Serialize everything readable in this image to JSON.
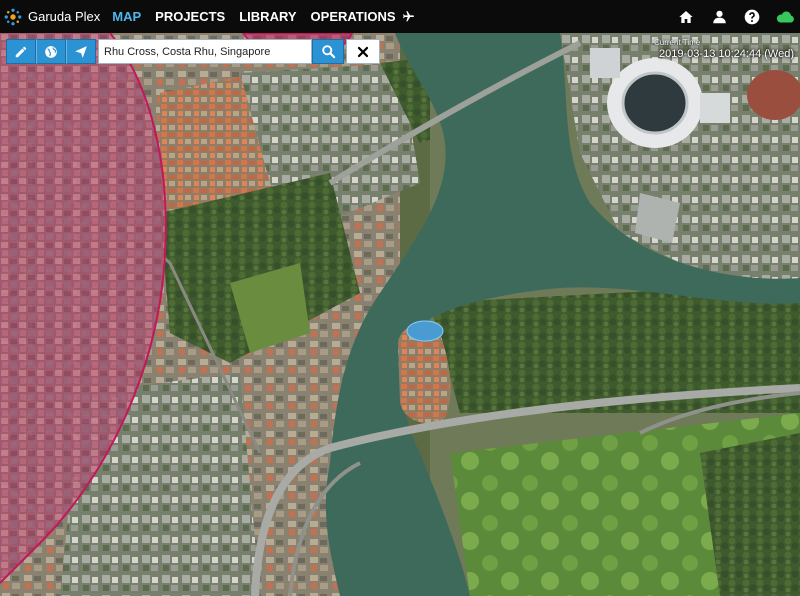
{
  "app": {
    "brand": "Garuda Plex"
  },
  "nav": {
    "items": [
      {
        "label": "MAP",
        "active": true
      },
      {
        "label": "PROJECTS",
        "active": false
      },
      {
        "label": "LIBRARY",
        "active": false
      },
      {
        "label": "OPERATIONS",
        "active": false,
        "icon": "plane-icon"
      }
    ],
    "right_icons": [
      "home-icon",
      "user-icon",
      "help-icon",
      "cloud-icon"
    ],
    "accent_color": "#4fb6ee",
    "cloud_color": "#38c75a"
  },
  "toolbar": {
    "tools": [
      "pencil-icon",
      "globe-icon",
      "send-icon"
    ],
    "search": {
      "value": "Rhu Cross, Costa Rhu, Singapore",
      "placeholder": ""
    },
    "search_icon": "search-icon",
    "clear_icon": "close-icon",
    "button_color": "#2b93d3"
  },
  "clock": {
    "label": "Current Time",
    "time": "2019-03-13 10:24:44 (Wed)"
  },
  "map": {
    "type": "satellite",
    "overlay_zones": [
      {
        "kind": "restricted-zone",
        "color": "#c2185b"
      },
      {
        "kind": "restricted-zone",
        "color": "#c2185b"
      }
    ],
    "water_color": "#3d6b5e"
  }
}
